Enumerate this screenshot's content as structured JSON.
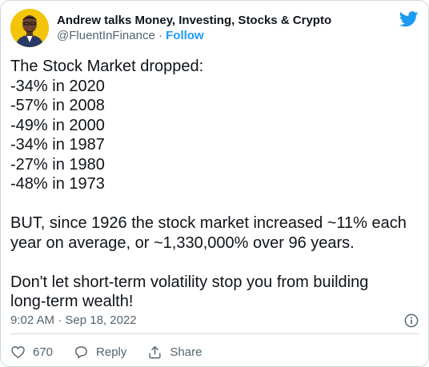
{
  "author": {
    "display_name": "Andrew talks Money, Investing, Stocks & Crypto",
    "handle": "@FluentInFinance",
    "separator": " · ",
    "follow_label": "Follow"
  },
  "tweet": {
    "lines": [
      "The Stock Market dropped:",
      "-34% in 2020",
      "-57% in 2008",
      "-49% in 2000",
      "-34% in 1987",
      "-27% in 1980",
      "-48% in 1973",
      "",
      "BUT, since 1926 the stock market increased ~11% each",
      "year on average, or ~1,330,000% over 96 years.",
      "",
      "Don't let short-term volatility stop you from building",
      "long-term wealth!"
    ]
  },
  "meta": {
    "timestamp": "9:02 AM · Sep 18, 2022"
  },
  "actions": {
    "like_count": "670",
    "reply_label": "Reply",
    "share_label": "Share"
  },
  "colors": {
    "accent": "#1d9bf0",
    "avatar_bg": "#f2c50a",
    "text": "#0f1419",
    "secondary": "#536471"
  },
  "icons": [
    "twitter-bird-icon",
    "info-icon",
    "heart-icon",
    "reply-icon",
    "share-icon"
  ]
}
